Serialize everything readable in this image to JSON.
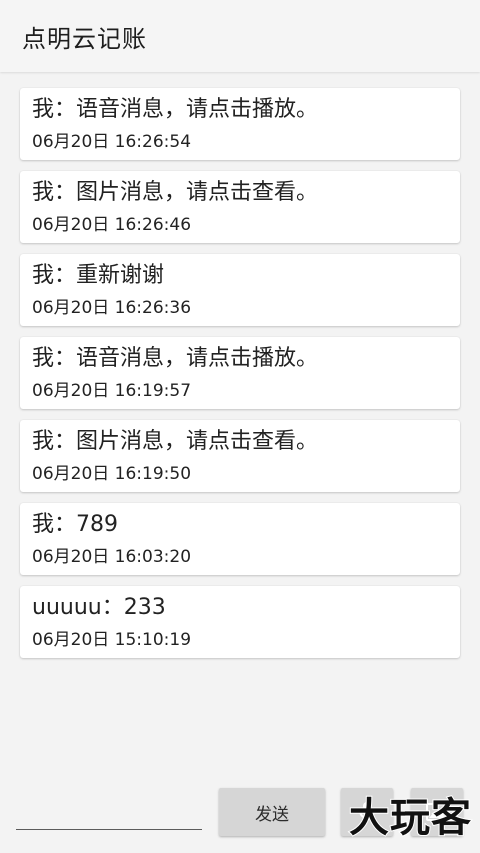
{
  "app": {
    "title": "点明云记账"
  },
  "messages": [
    {
      "text": "我：语音消息，请点击播放。",
      "time": "06月20日 16:26:54"
    },
    {
      "text": "我：图片消息，请点击查看。",
      "time": "06月20日 16:26:46"
    },
    {
      "text": "我：重新谢谢",
      "time": "06月20日 16:26:36"
    },
    {
      "text": "我：语音消息，请点击播放。",
      "time": "06月20日 16:19:57"
    },
    {
      "text": "我：图片消息，请点击查看。",
      "time": "06月20日 16:19:50"
    },
    {
      "text": "我：789",
      "time": "06月20日 16:03:20"
    },
    {
      "text": "uuuuu：233",
      "time": "06月20日 15:10:19"
    }
  ],
  "composer": {
    "input_value": "",
    "send_label": "发送",
    "voice_icon": "microphone-icon",
    "image_icon": "image-icon"
  },
  "watermark": {
    "text": "大玩客"
  },
  "colors": {
    "background": "#f3f3f3",
    "card": "#ffffff",
    "button": "#d6d6d6"
  }
}
